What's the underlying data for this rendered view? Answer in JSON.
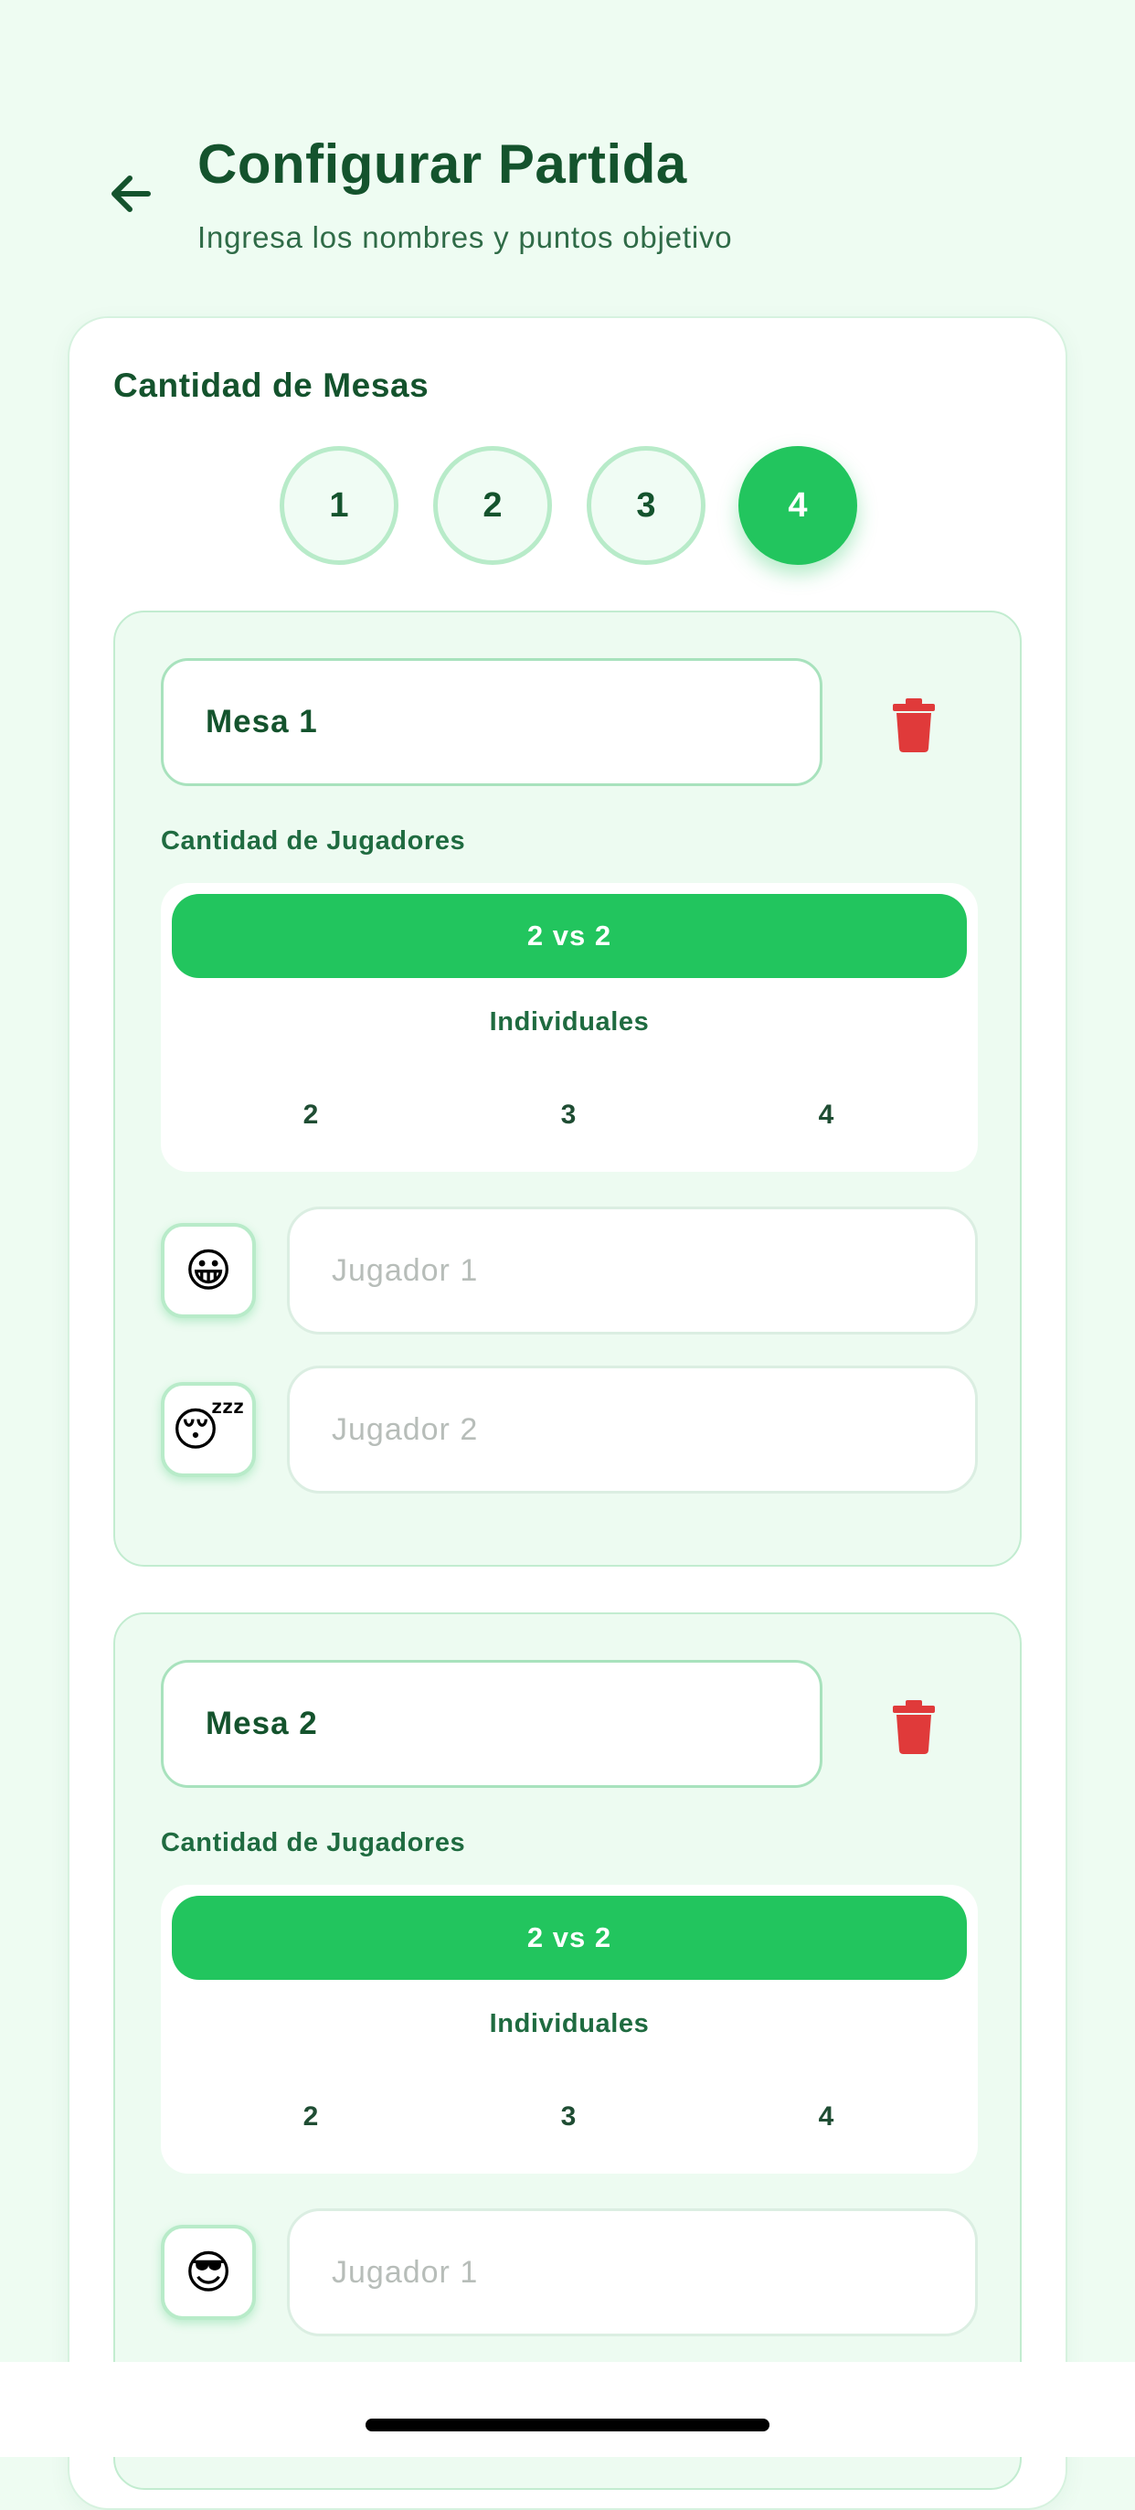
{
  "header": {
    "title": "Configurar Partida",
    "subtitle": "Ingresa los nombres y puntos objetivo"
  },
  "config": {
    "tables_label": "Cantidad de Mesas",
    "table_count_options": [
      "1",
      "2",
      "3",
      "4"
    ],
    "selected_table_count": "4"
  },
  "mesas": [
    {
      "name": "Mesa 1",
      "players_label": "Cantidad de Jugadores",
      "team_mode": "2 vs 2",
      "individual_label": "Individuales",
      "individual_options": [
        "2",
        "3",
        "4"
      ],
      "players": [
        {
          "emoji": "😀",
          "placeholder": "Jugador 1"
        },
        {
          "emoji": "😴",
          "placeholder": "Jugador 2"
        }
      ]
    },
    {
      "name": "Mesa 2",
      "players_label": "Cantidad de Jugadores",
      "team_mode": "2 vs 2",
      "individual_label": "Individuales",
      "individual_options": [
        "2",
        "3",
        "4"
      ],
      "players": [
        {
          "emoji": "😎",
          "placeholder": "Jugador 1"
        }
      ]
    }
  ],
  "colors": {
    "background": "#eefcf2",
    "accent": "#22c55e",
    "title_text": "#14532d",
    "delete": "#e03a3a"
  },
  "icons": {
    "back": "arrow-left-icon",
    "delete": "trash-icon"
  }
}
